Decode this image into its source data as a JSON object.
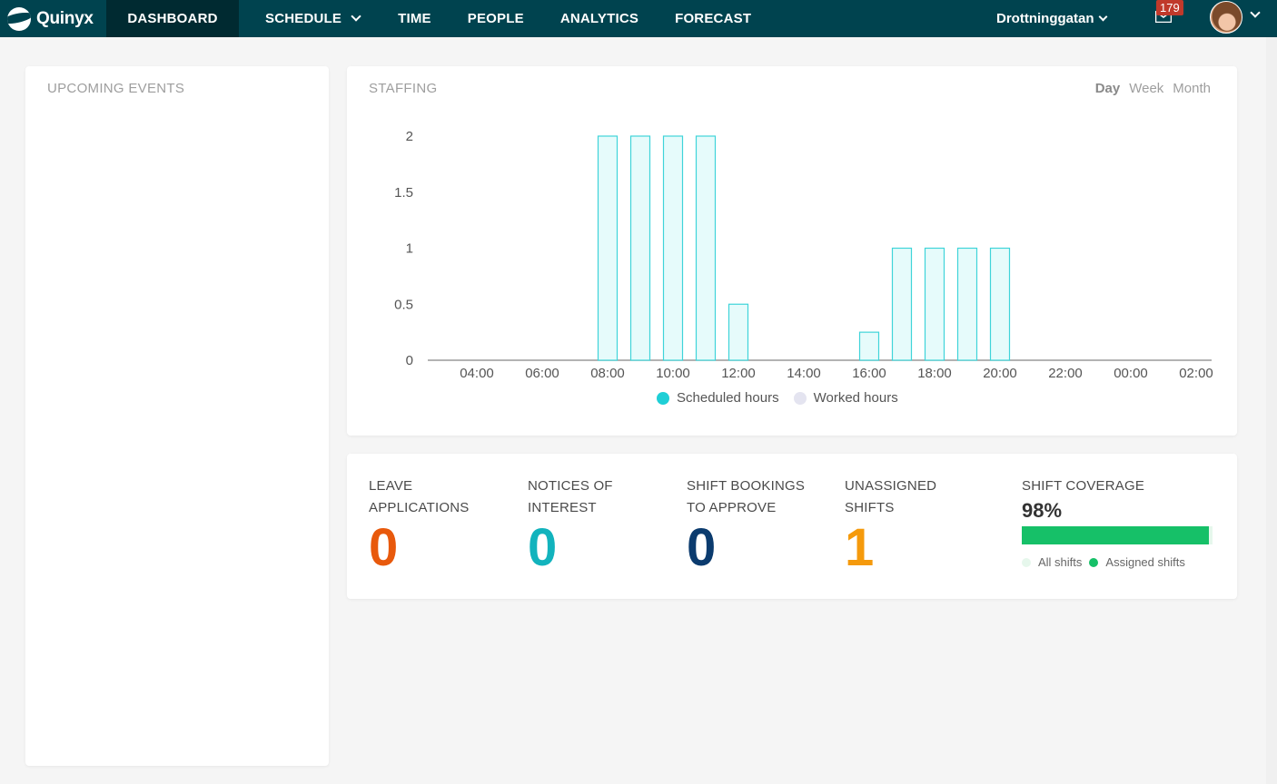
{
  "brand": {
    "name": "Quinyx"
  },
  "nav": {
    "items": [
      {
        "label": "DASHBOARD",
        "active": true
      },
      {
        "label": "SCHEDULE",
        "dropdown": true
      },
      {
        "label": "TIME"
      },
      {
        "label": "PEOPLE"
      },
      {
        "label": "ANALYTICS"
      },
      {
        "label": "FORECAST"
      }
    ],
    "location": "Drottninggatan",
    "notifications": "179"
  },
  "events": {
    "title": "UPCOMING EVENTS"
  },
  "staffing": {
    "title": "STAFFING",
    "ranges": [
      "Day",
      "Week",
      "Month"
    ],
    "selected_range": "Day"
  },
  "chart_data": {
    "type": "bar",
    "x_ticks": [
      "04:00",
      "06:00",
      "08:00",
      "10:00",
      "12:00",
      "14:00",
      "16:00",
      "18:00",
      "20:00",
      "22:00",
      "00:00",
      "02:00"
    ],
    "y_ticks": [
      "0",
      "0.5",
      "1",
      "1.5",
      "2"
    ],
    "ylim": [
      0,
      2
    ],
    "series": [
      {
        "name": "Scheduled hours",
        "color": "#1fcfd6",
        "points": [
          {
            "x": "08:00",
            "y": 2
          },
          {
            "x": "09:00",
            "y": 2
          },
          {
            "x": "10:00",
            "y": 2
          },
          {
            "x": "11:00",
            "y": 2
          },
          {
            "x": "12:00",
            "y": 0.5
          },
          {
            "x": "16:00",
            "y": 0.25
          },
          {
            "x": "17:00",
            "y": 1
          },
          {
            "x": "18:00",
            "y": 1
          },
          {
            "x": "19:00",
            "y": 1
          },
          {
            "x": "20:00",
            "y": 1
          }
        ]
      },
      {
        "name": "Worked hours",
        "color": "#e4e4f0",
        "points": []
      }
    ],
    "legend_position": "bottom"
  },
  "stats": [
    {
      "label": "LEAVE APPLICATIONS",
      "value": "0",
      "color": "#e8590c"
    },
    {
      "label": "NOTICES OF INTEREST",
      "value": "0",
      "color": "#12b3bd"
    },
    {
      "label": "SHIFT BOOKINGS TO APPROVE",
      "value": "0",
      "color": "#0b3b6e"
    },
    {
      "label": "UNASSIGNED SHIFTS",
      "value": "1",
      "color": "#f59a0c"
    }
  ],
  "coverage": {
    "label": "SHIFT COVERAGE",
    "value": "98%",
    "fraction": 0.98,
    "legend_all": "All shifts",
    "legend_assigned": "Assigned shifts",
    "color_all": "#e6f7ec",
    "color_assigned": "#16c068"
  }
}
